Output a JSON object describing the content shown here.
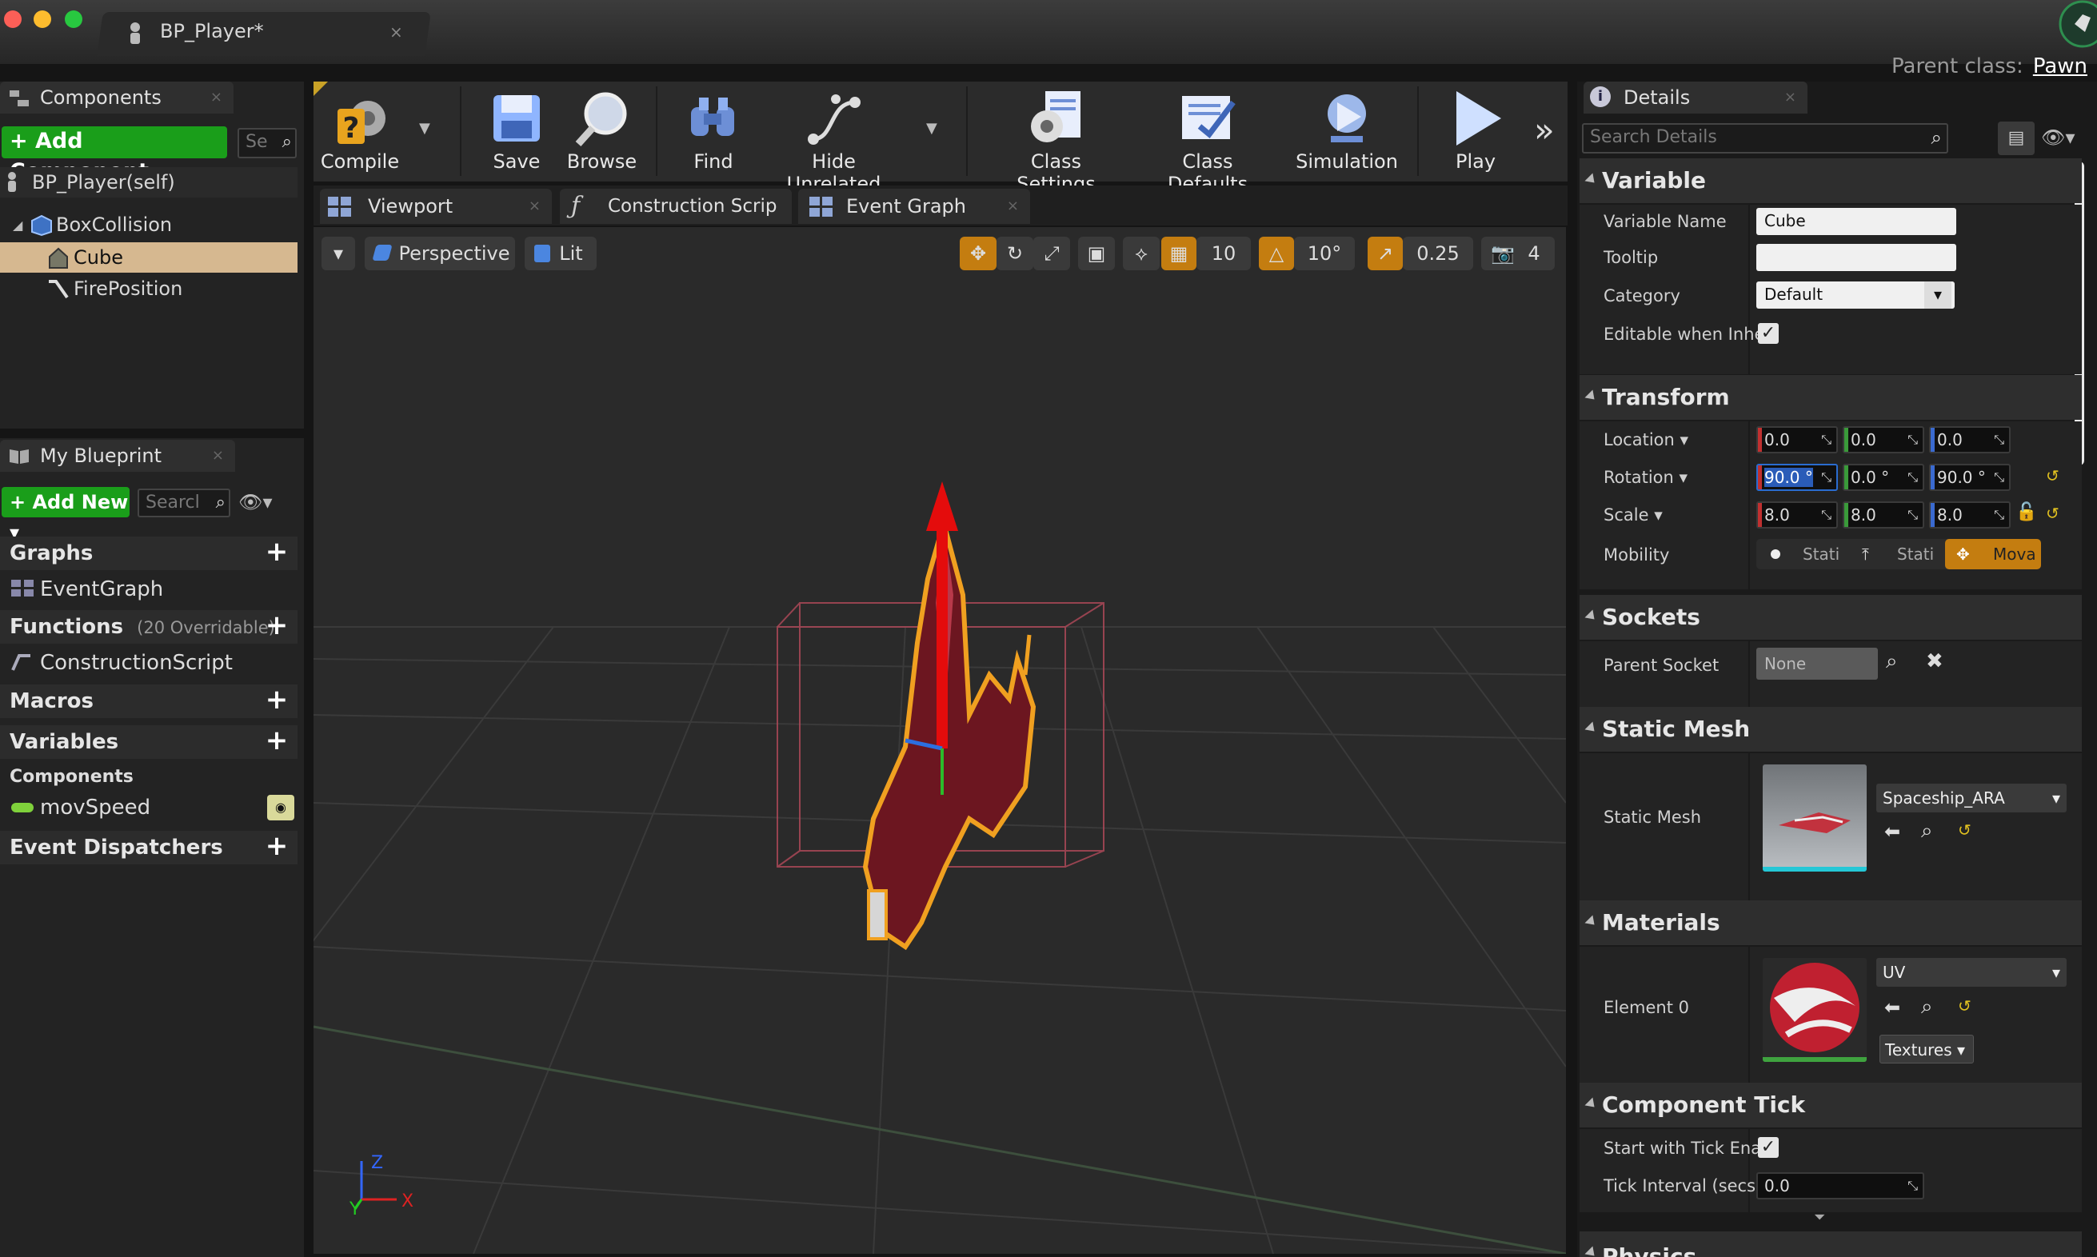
{
  "window": {
    "tab_title": "BP_Player*",
    "parent_class_label": "Parent class:",
    "parent_class_value": "Pawn"
  },
  "components_panel": {
    "title": "Components",
    "add_component": "+ Add Component",
    "search_placeholder": "Se",
    "self_item": "BP_Player(self)",
    "tree": [
      "BoxCollision",
      "Cube",
      "FirePosition"
    ],
    "selected": "Cube"
  },
  "my_blueprint": {
    "title": "My Blueprint",
    "add_new": "+ Add New",
    "search_placeholder": "Searcl",
    "graphs_label": "Graphs",
    "event_graph": "EventGraph",
    "functions_label": "Functions",
    "functions_count": "(20 Overridable)",
    "construction_script": "ConstructionScript",
    "macros_label": "Macros",
    "variables_label": "Variables",
    "components_label": "Components",
    "mov_speed": "movSpeed",
    "event_dispatchers_label": "Event Dispatchers"
  },
  "toolbar": {
    "compile": "Compile",
    "save": "Save",
    "browse": "Browse",
    "find": "Find",
    "hide_unrelated": "Hide Unrelated",
    "class_settings": "Class Settings",
    "class_defaults": "Class Defaults",
    "simulation": "Simulation",
    "play": "Play"
  },
  "editor_tabs": {
    "viewport": "Viewport",
    "construction": "Construction Scrip",
    "event_graph": "Event Graph"
  },
  "viewport": {
    "perspective": "Perspective",
    "lit": "Lit",
    "grid_snap": "10",
    "rot_snap": "10°",
    "scale_snap": "0.25",
    "camera_speed": "4",
    "axis_x": "X",
    "axis_y": "Y",
    "axis_z": "Z"
  },
  "details": {
    "title": "Details",
    "search_placeholder": "Search Details",
    "variable_section": "Variable",
    "variable_name_label": "Variable Name",
    "variable_name_value": "Cube",
    "tooltip_label": "Tooltip",
    "tooltip_value": "",
    "category_label": "Category",
    "category_value": "Default",
    "editable_label": "Editable when Inhei",
    "transform_section": "Transform",
    "location_label": "Location",
    "location": [
      "0.0",
      "0.0",
      "0.0"
    ],
    "rotation_label": "Rotation",
    "rotation": [
      "90.0 °",
      "0.0 °",
      "90.0 °"
    ],
    "scale_label": "Scale",
    "scale": [
      "8.0",
      "8.0",
      "8.0"
    ],
    "mobility_label": "Mobility",
    "mobility_options": [
      "Stati",
      "Stati",
      "Mova"
    ],
    "sockets_section": "Sockets",
    "parent_socket_label": "Parent Socket",
    "parent_socket_value": "None",
    "static_mesh_section": "Static Mesh",
    "static_mesh_label": "Static Mesh",
    "static_mesh_value": "Spaceship_ARA",
    "materials_section": "Materials",
    "element0_label": "Element 0",
    "element0_value": "UV",
    "textures_button": "Textures",
    "component_tick_section": "Component Tick",
    "start_tick_label": "Start with Tick Enal",
    "tick_interval_label": "Tick Interval (secs)",
    "tick_interval_value": "0.0",
    "physics_section": "Physics"
  },
  "colors": {
    "accent_orange": "#c47d10",
    "add_green": "#1a9e1a",
    "selection": "#d6b890",
    "axis_x": "#d22",
    "axis_y": "#2c2",
    "axis_z": "#36f"
  }
}
